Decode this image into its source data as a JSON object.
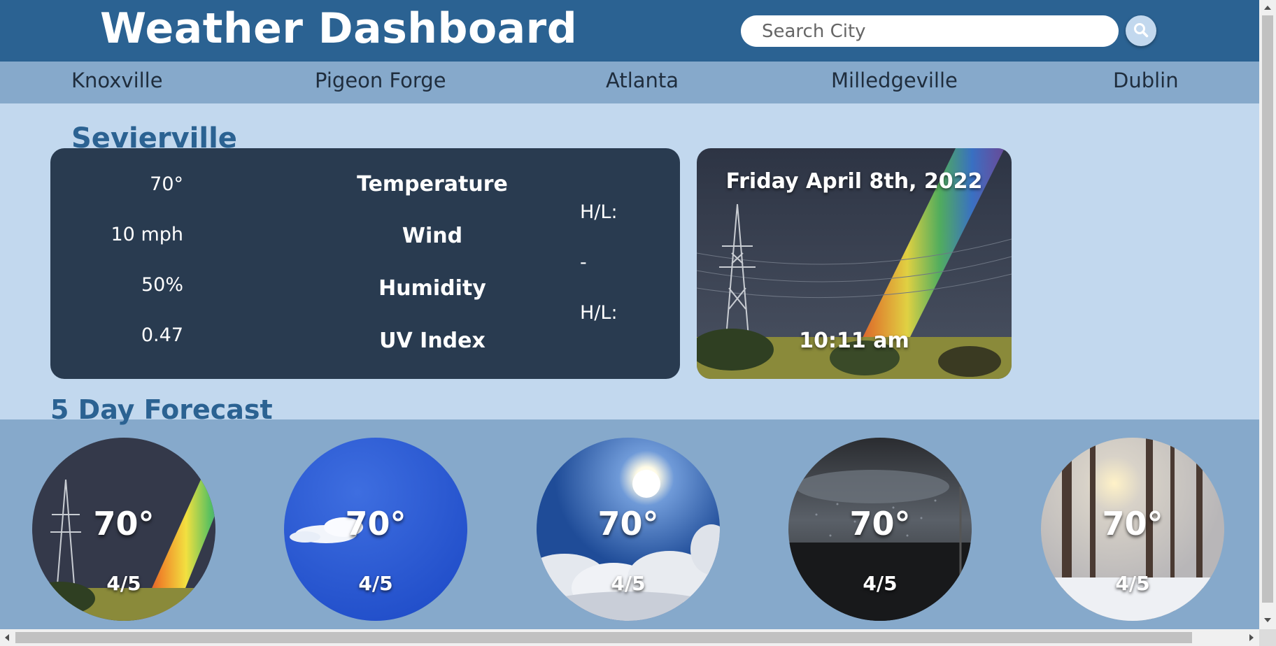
{
  "header": {
    "title": "Weather Dashboard",
    "search_placeholder": "Search City",
    "search_icon": "search-icon"
  },
  "cities": [
    "Knoxville",
    "Pigeon Forge",
    "Atlanta",
    "Milledgeville",
    "Dublin"
  ],
  "current": {
    "city": "Sevierville",
    "metrics": [
      {
        "value": "70°",
        "label": "Temperature"
      },
      {
        "value": "10 mph",
        "label": "Wind"
      },
      {
        "value": "50%",
        "label": "Humidity"
      },
      {
        "value": "0.47",
        "label": "UV Index"
      }
    ],
    "high_low_1": "H/L:",
    "separator": "-",
    "high_low_2": "H/L:"
  },
  "date_card": {
    "date": "Friday April 8th, 2022",
    "time": "10:11 am"
  },
  "forecast": {
    "title": "5 Day Forecast",
    "days": [
      {
        "temp": "70°",
        "hl": "4/5",
        "image": "rainbow"
      },
      {
        "temp": "70°",
        "hl": "4/5",
        "image": "blue-sky"
      },
      {
        "temp": "70°",
        "hl": "4/5",
        "image": "sun-clouds"
      },
      {
        "temp": "70°",
        "hl": "4/5",
        "image": "rainy-window"
      },
      {
        "temp": "70°",
        "hl": "4/5",
        "image": "snowy-forest"
      }
    ]
  },
  "colors": {
    "header_bg": "#2b6292",
    "nav_bg": "#86a9cb",
    "page_bg": "#c2d8ee",
    "card_bg": "#293b50",
    "accent_text": "#2b6292"
  }
}
